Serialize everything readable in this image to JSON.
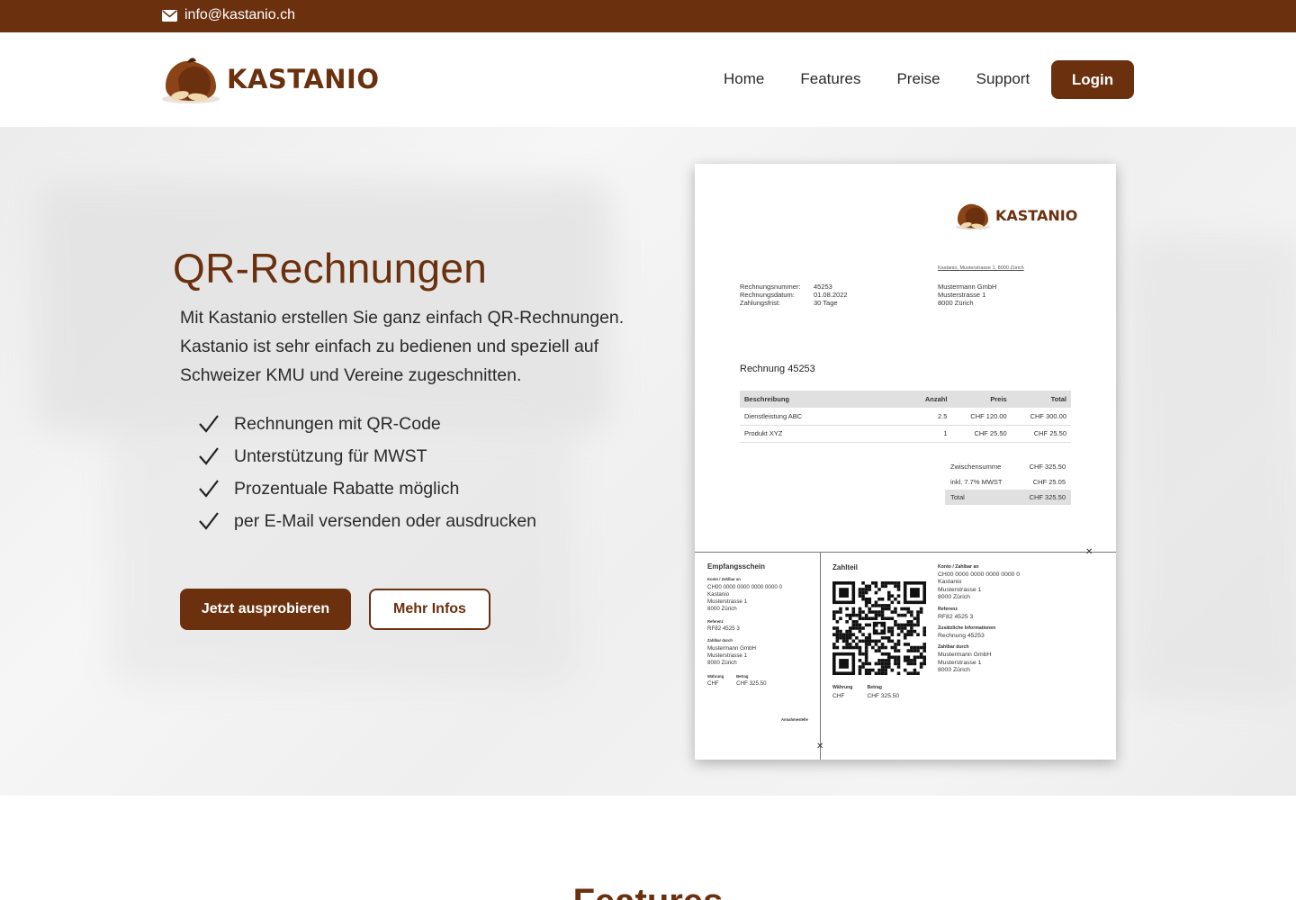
{
  "topbar": {
    "email": "info@kastanio.ch",
    "icon": "envelope-icon"
  },
  "brand": {
    "name": "KASTANIO",
    "color": "#6b310f"
  },
  "nav": {
    "items": [
      "Home",
      "Features",
      "Preise",
      "Support"
    ],
    "login": "Login"
  },
  "hero": {
    "title": "QR-Rechnungen",
    "text": "Mit Kastanio erstellen Sie ganz einfach QR-Rechnungen. Kastanio ist sehr einfach zu bedienen und speziell auf Schweizer KMU und Vereine zugeschnitten.",
    "features": [
      "Rechnungen mit QR-Code",
      "Unterstützung für MWST",
      "Prozentuale Rabatte möglich",
      "per E-Mail versenden oder ausdrucken"
    ],
    "cta_primary": "Jetzt ausprobieren",
    "cta_secondary": "Mehr Infos"
  },
  "invoice": {
    "logo": "KASTANIO",
    "sender_line": "Kastanio, Musterstrasse 1, 8000 Zürich",
    "meta": [
      {
        "k": "Rechnungsnummer:",
        "v": "45253"
      },
      {
        "k": "Rechnungsdatum:",
        "v": "01.08.2022"
      },
      {
        "k": "Zahlungsfrist:",
        "v": "30 Tage"
      }
    ],
    "recipient": [
      "Mustermann GmbH",
      "Musterstrasse 1",
      "8000 Zürich"
    ],
    "title": "Rechnung 45253",
    "table_headers": [
      "Beschreibung",
      "Anzahl",
      "Preis",
      "Total"
    ],
    "rows": [
      [
        "Dienstleistung ABC",
        "2.5",
        "CHF 120.00",
        "CHF 300.00"
      ],
      [
        "Produkt XYZ",
        "1",
        "CHF 25.50",
        "CHF 25.50"
      ]
    ],
    "totals": [
      {
        "k": "Zwischensumme",
        "v": "CHF 325.50"
      },
      {
        "k": "inkl. 7.7% MWST",
        "v": "CHF 25.05"
      },
      {
        "k": "Total",
        "v": "CHF 325.50"
      }
    ],
    "receipt": {
      "title": "Empfangsschein",
      "konto_label": "Konto / Zahlbar an",
      "konto": [
        "CH00 0000 0000 0000 0000 0",
        "Kastanio",
        "Musterstrasse 1",
        "8000 Zürich"
      ],
      "ref_label": "Referenz",
      "ref": "RF82 4525 3",
      "payer_label": "Zahlbar durch",
      "payer": [
        "Mustermann GmbH",
        "Musterstrasse 1",
        "8000 Zürich"
      ],
      "currency_label": "Währung",
      "amount_label": "Betrag",
      "currency": "CHF",
      "amount": "CHF 325.50",
      "acceptance": "Annahmestelle"
    },
    "payslip": {
      "title": "Zahlteil",
      "konto_label": "Konto / Zahlbar an",
      "konto": [
        "CH00 0000 0000 0000 0000 0",
        "Kastanio",
        "Musterstrasse 1",
        "8000 Zürich"
      ],
      "ref_label": "Referenz",
      "ref": "RF82 4525 3",
      "info_label": "Zusätzliche Informationen",
      "info": "Rechnung 45253",
      "payer_label": "Zahlbar durch",
      "payer": [
        "Mustermann GmbH",
        "Musterstrasse 1",
        "8000 Zürich"
      ],
      "currency_label": "Währung",
      "amount_label": "Betrag",
      "currency": "CHF",
      "amount": "CHF 325.50"
    }
  },
  "section": {
    "features_heading": "Features"
  }
}
